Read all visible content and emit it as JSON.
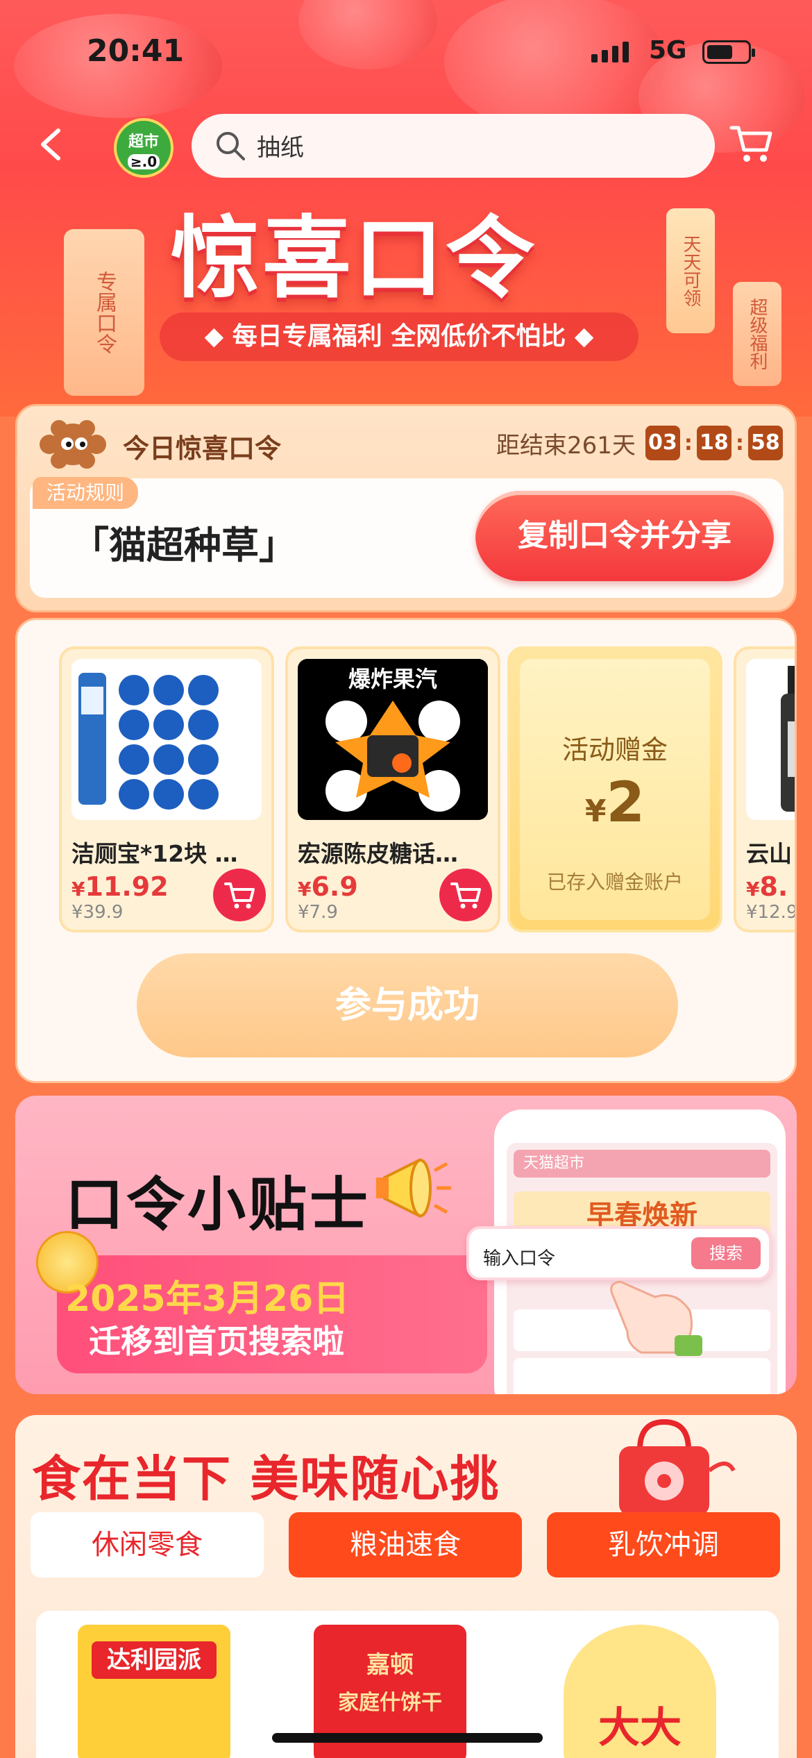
{
  "status_bar": {
    "time": "20:41",
    "network": "5G"
  },
  "nav": {
    "logo_label": "超市",
    "logo_face": "≥.0",
    "search_value": "抽纸"
  },
  "banner": {
    "title": "惊喜口令",
    "subtitle": "◆ 每日专属福利 全网低价不怕比 ◆",
    "tag_left": "专属口令",
    "tag_right1": "天天可领",
    "tag_right2": "超级福利"
  },
  "code_card": {
    "title": "今日惊喜口令",
    "countdown_label": "距结束261天",
    "countdown": [
      "03",
      "18",
      "58"
    ],
    "rules_label": "活动规则",
    "code_text": "「猫超种草」",
    "copy_button": "复制口令并分享"
  },
  "products": [
    {
      "name": "洁厕宝*12块 …",
      "price": "11.92",
      "old_price": "¥39.9"
    },
    {
      "name": "宏源陈皮糖话…",
      "price": "6.9",
      "old_price": "¥7.9",
      "image_text": "爆炸果汽"
    }
  ],
  "bonus": {
    "label": "活动赠金",
    "currency": "¥",
    "amount": "2",
    "note": "已存入赠金账户"
  },
  "partial_product": {
    "name": "云山",
    "price": "8.",
    "old_price": "¥12.9"
  },
  "join_button": "参与成功",
  "tips": {
    "title": "口令小贴士",
    "date": "2025年3月26日",
    "move_text": "迁移到首页搜索啦",
    "mini_search_placeholder": "输入口令",
    "mini_search_button": "搜索",
    "phone_header": "天猫超市",
    "phone_banner": "早春焕新"
  },
  "food": {
    "title": "食在当下 美味随心挑",
    "tabs": [
      "休闲零食",
      "粮油速食",
      "乳饮冲调"
    ],
    "active_tab": 0,
    "items": [
      {
        "label": "达利园派"
      },
      {
        "label": "嘉顿",
        "sub": "家庭什饼干"
      },
      {
        "label": "大大"
      }
    ]
  },
  "colors": {
    "accent": "#e8262b",
    "banner": "#ff4a4a",
    "gold": "#8a5a18"
  }
}
